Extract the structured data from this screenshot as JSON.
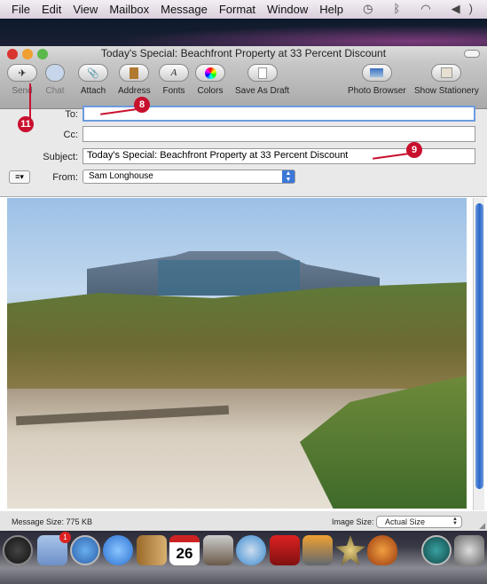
{
  "menubar": {
    "items": [
      "File",
      "Edit",
      "View",
      "Mailbox",
      "Message",
      "Format",
      "Window",
      "Help"
    ],
    "status_icons": [
      "time-machine-icon",
      "bluetooth-icon",
      "wifi-icon",
      "volume-icon"
    ]
  },
  "window": {
    "title": "Today's Special: Beachfront Property at 33 Percent Discount"
  },
  "toolbar": {
    "send": "Send",
    "chat": "Chat",
    "attach": "Attach",
    "address": "Address",
    "fonts": "Fonts",
    "colors": "Colors",
    "save_draft": "Save As Draft",
    "photo_browser": "Photo Browser",
    "show_stationery": "Show Stationery"
  },
  "header": {
    "to_label": "To:",
    "to_value": "",
    "cc_label": "Cc:",
    "cc_value": "",
    "subject_label": "Subject:",
    "subject_value": "Today's Special: Beachfront Property at 33 Percent Discount",
    "from_label": "From:",
    "from_value": "Sam Longhouse"
  },
  "footer": {
    "message_size": "Message Size: 775 KB",
    "image_size_label": "Image Size:",
    "image_size_value": "Actual Size"
  },
  "callouts": {
    "to": "8",
    "subject": "9",
    "send": "11"
  },
  "dock": {
    "mail_badge": "1",
    "ical_day": "26"
  },
  "colors": {
    "callout": "#c8102e",
    "focus": "#6b9be0"
  }
}
